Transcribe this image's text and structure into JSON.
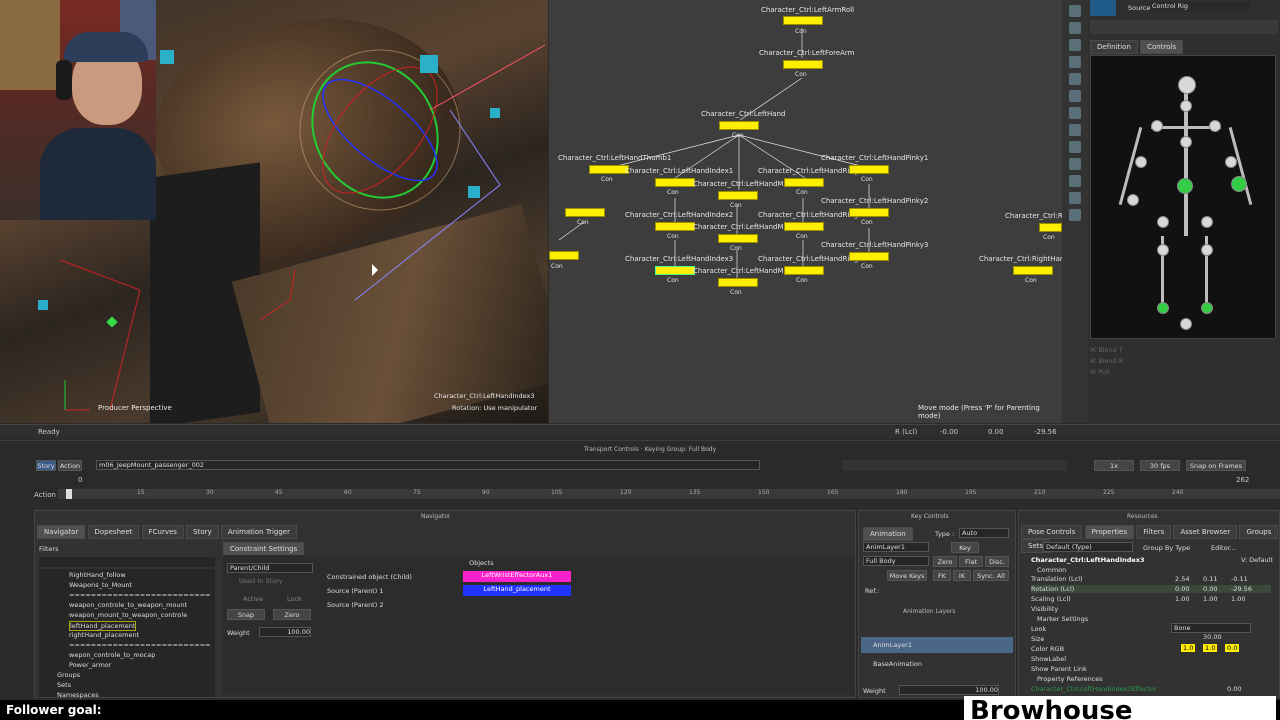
{
  "viewport": {
    "camera_label": "Producer Perspective",
    "object_label": "Character_Ctrl:LeftHandIndex3",
    "rotation_label": "Rotation: Use manipulator"
  },
  "graph": {
    "nodes": [
      {
        "label": "Character_Ctrl:LeftArmRoll",
        "con": "Con"
      },
      {
        "label": "Character_Ctrl:LeftForeArm",
        "con": "Con"
      },
      {
        "label": "Character_Ctrl:LeftHand",
        "con": "Con"
      },
      {
        "label": "Character_Ctrl:LeftHandThumb1",
        "con": "Con"
      },
      {
        "label": "Character_Ctrl:LeftHandIndex1",
        "con": "Con"
      },
      {
        "label": "Character_Ctrl:LeftHandMiddle",
        "con": "Con"
      },
      {
        "label": "Character_Ctrl:LeftHandRing",
        "con": "Con"
      },
      {
        "label": "Character_Ctrl:LeftHandPinky1",
        "con": "Con"
      },
      {
        "label": "Character_Ctrl:LeftHandIndex2",
        "con": "Con"
      },
      {
        "label": "Character_Ctrl:LeftHandMiddle",
        "con": "Con"
      },
      {
        "label": "Character_Ctrl:LeftHandRing",
        "con": "Con"
      },
      {
        "label": "Character_Ctrl:LeftHandPinky2",
        "con": "Con"
      },
      {
        "label": "Character_Ctrl:LeftHandIndex3",
        "con": "Con"
      },
      {
        "label": "Character_Ctrl:LeftHandMiddle",
        "con": "Con"
      },
      {
        "label": "Character_Ctrl:LeftHandRing",
        "con": "Con"
      },
      {
        "label": "Character_Ctrl:LeftHandPinky3",
        "con": "Con"
      },
      {
        "label": "Character_Ctrl:RightHand",
        "con": "Con"
      },
      {
        "label": "Character_Ctrl:Rig",
        "con": "Con"
      }
    ],
    "status": "Move mode (Press 'P' for Parenting mode)"
  },
  "char_panel": {
    "source_label": "Source:",
    "source_value": "Control Rig",
    "tabs": [
      "Definition",
      "Controls"
    ],
    "ik": [
      "IK Blend T",
      "IK Blend R",
      "IK Pull"
    ]
  },
  "status": {
    "ready": "Ready",
    "rlcl": "R (Lcl)",
    "x": "-0.00",
    "y": "0.00",
    "z": "-29.56"
  },
  "transport": {
    "title": "Transport Controls  ·  Keying Group: Full Body",
    "story": "Story",
    "action": "Action",
    "take": "m06_JeepMount_passenger_002",
    "fps": "30 fps",
    "snap": "Snap on Frames",
    "speed": "1x",
    "start": "0",
    "end": "262",
    "ticks": [
      "15",
      "30",
      "45",
      "60",
      "75",
      "90",
      "105",
      "120",
      "135",
      "150",
      "165",
      "180",
      "195",
      "210",
      "225",
      "240"
    ],
    "label_action": "Action"
  },
  "navigator": {
    "title": "Navigator",
    "tabs": [
      "Navigator",
      "Dopesheet",
      "FCurves",
      "Story",
      "Animation Trigger"
    ],
    "filters": "Filters",
    "tree": [
      "RightHand_follow",
      "Weapons_to_Mount",
      "==========================",
      "weapon_controle_to_weapon_mount",
      "weapon_mount_to_weapon_controle",
      "leftHand_placement",
      "rightHand_placement",
      "==========================",
      "wepon_controle_to_mocap",
      "Power_armor",
      "Groups",
      "Sets",
      "Namespaces"
    ],
    "settings_tab": "Constraint Settings",
    "type": "Parent/Child",
    "used_in_story": "Used In Story",
    "active": "Active",
    "lock": "Lock",
    "snap": "Snap",
    "zero": "Zero",
    "weight_label": "Weight",
    "weight_value": "100.00",
    "objects_header": "Objects",
    "constrained": "Constrained object (Child)",
    "source1": "Source (Parent) 1",
    "source2": "Source (Parent) 2",
    "obj_child": "LeftWristEffectorAux1",
    "obj_parent": "LeftHand_placement"
  },
  "keys": {
    "title": "Key Controls",
    "animation_tab": "Animation",
    "type_label": "Type :",
    "type_value": "Auto",
    "layer": "AnimLayer1",
    "key": "Key",
    "fullbody": "Full Body",
    "zero": "Zero",
    "flat": "Flat",
    "disc": "Disc.",
    "move_keys": "Move Keys",
    "fk": "FK",
    "ik": "IK",
    "sync": "Sync. All",
    "ref": "Ref.:",
    "layers_title": "Animation Layers",
    "layer1": "AnimLayer1",
    "base": "BaseAnimation",
    "weight_label": "Weight",
    "weight_value": "100.00"
  },
  "resources": {
    "title": "Resources",
    "tabs": [
      "Pose Controls",
      "Properties",
      "Filters",
      "Asset Browser",
      "Groups",
      "Sets"
    ],
    "default_type": "Default (Type)",
    "group_by": "Group By Type",
    "editor": "Editor...",
    "object": "Character_Ctrl:LeftHandIndex3",
    "vdefault": "V: Default",
    "common": "Common",
    "translation": "Translation (Lcl)",
    "t": [
      "2.54",
      "0.11",
      "-0.11"
    ],
    "rotation": "Rotation (Lcl)",
    "r": [
      "0.00",
      "0.00",
      "-29.56"
    ],
    "scaling": "Scaling (Lcl)",
    "s": [
      "1.00",
      "1.00",
      "1.00"
    ],
    "visibility": "Visibility",
    "marker": "Marker Settings",
    "look": "Look",
    "look_value": "Bone",
    "size": "Size",
    "size_value": "30.00",
    "color": "Color RGB",
    "c": [
      "1.0",
      "1.0",
      "0.0"
    ],
    "showlabel": "ShowLabel",
    "showparent": "Show Parent Link",
    "propref": "Property References",
    "lastrow": "Character_Ctrl:LeftHandIndex3Effector",
    "lastval": "0.00"
  },
  "footer": {
    "follower": "Follower goal:",
    "brand": "Browhouse"
  },
  "colors": {
    "node": "#ffee00",
    "magenta": "#ff22cc",
    "blue": "#2233ff",
    "green": "#33cc44"
  }
}
